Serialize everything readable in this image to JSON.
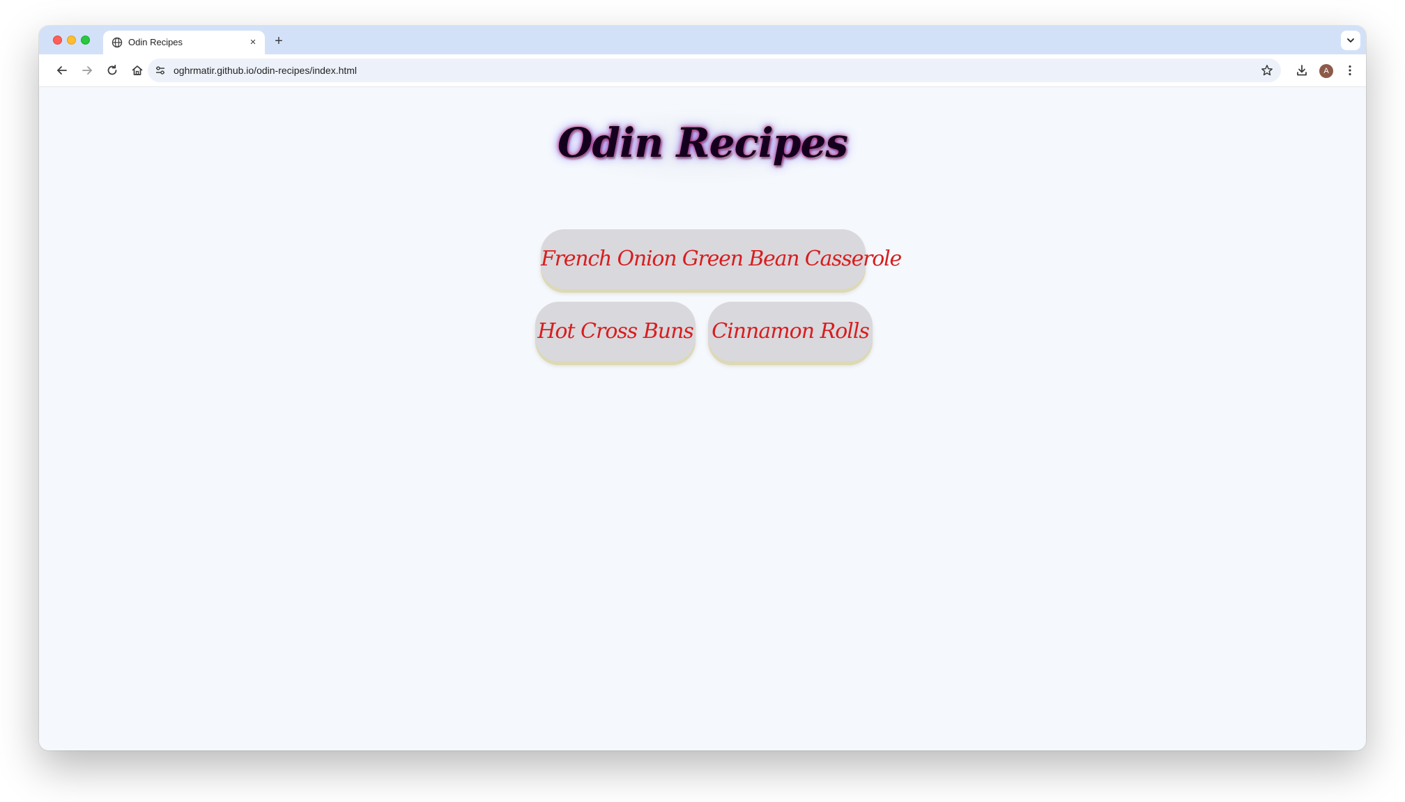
{
  "browser": {
    "tab": {
      "title": "Odin Recipes",
      "close_glyph": "×",
      "favicon": "globe-icon"
    },
    "new_tab_glyph": "+",
    "address_bar": {
      "url": "oghrmatir.github.io/odin-recipes/index.html"
    },
    "profile_initial": "A"
  },
  "page": {
    "title": "Odin Recipes",
    "recipes": [
      {
        "label": "French Onion Green Bean Casserole"
      },
      {
        "label": "Hot Cross Buns"
      },
      {
        "label": "Cinnamon Rolls"
      }
    ]
  },
  "colors": {
    "tab_strip": "#d3e1f8",
    "page_background": "#f5f8fd",
    "button_background": "#d9d8dd",
    "button_text": "#d81d1d",
    "title_text": "#14001e"
  }
}
